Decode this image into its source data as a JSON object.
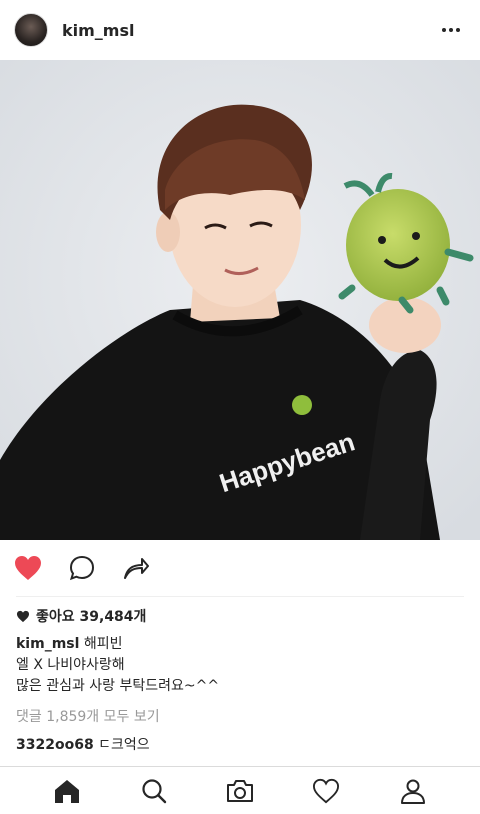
{
  "header": {
    "username": "kim_msl"
  },
  "photo": {
    "shirt_text": "Happybean"
  },
  "post": {
    "likes_label": "좋아요 39,484개",
    "caption_username": "kim_msl",
    "caption_line1": "해피빈",
    "caption_line2": "엘 X 나비야사랑해",
    "caption_line3": "많은 관심과 사랑 부탁드려요~^^",
    "view_comments": "댓글 1,859개 모두 보기",
    "comment_user": "3322oo68",
    "comment_text": "ㄷ크억으"
  },
  "colors": {
    "like_active": "#ed4956",
    "icon": "#262626"
  },
  "icons": {
    "actions": [
      "heart-icon",
      "comment-icon",
      "share-icon"
    ],
    "tabs": [
      "home-icon",
      "search-icon",
      "camera-icon",
      "activity-heart-icon",
      "profile-icon"
    ]
  }
}
